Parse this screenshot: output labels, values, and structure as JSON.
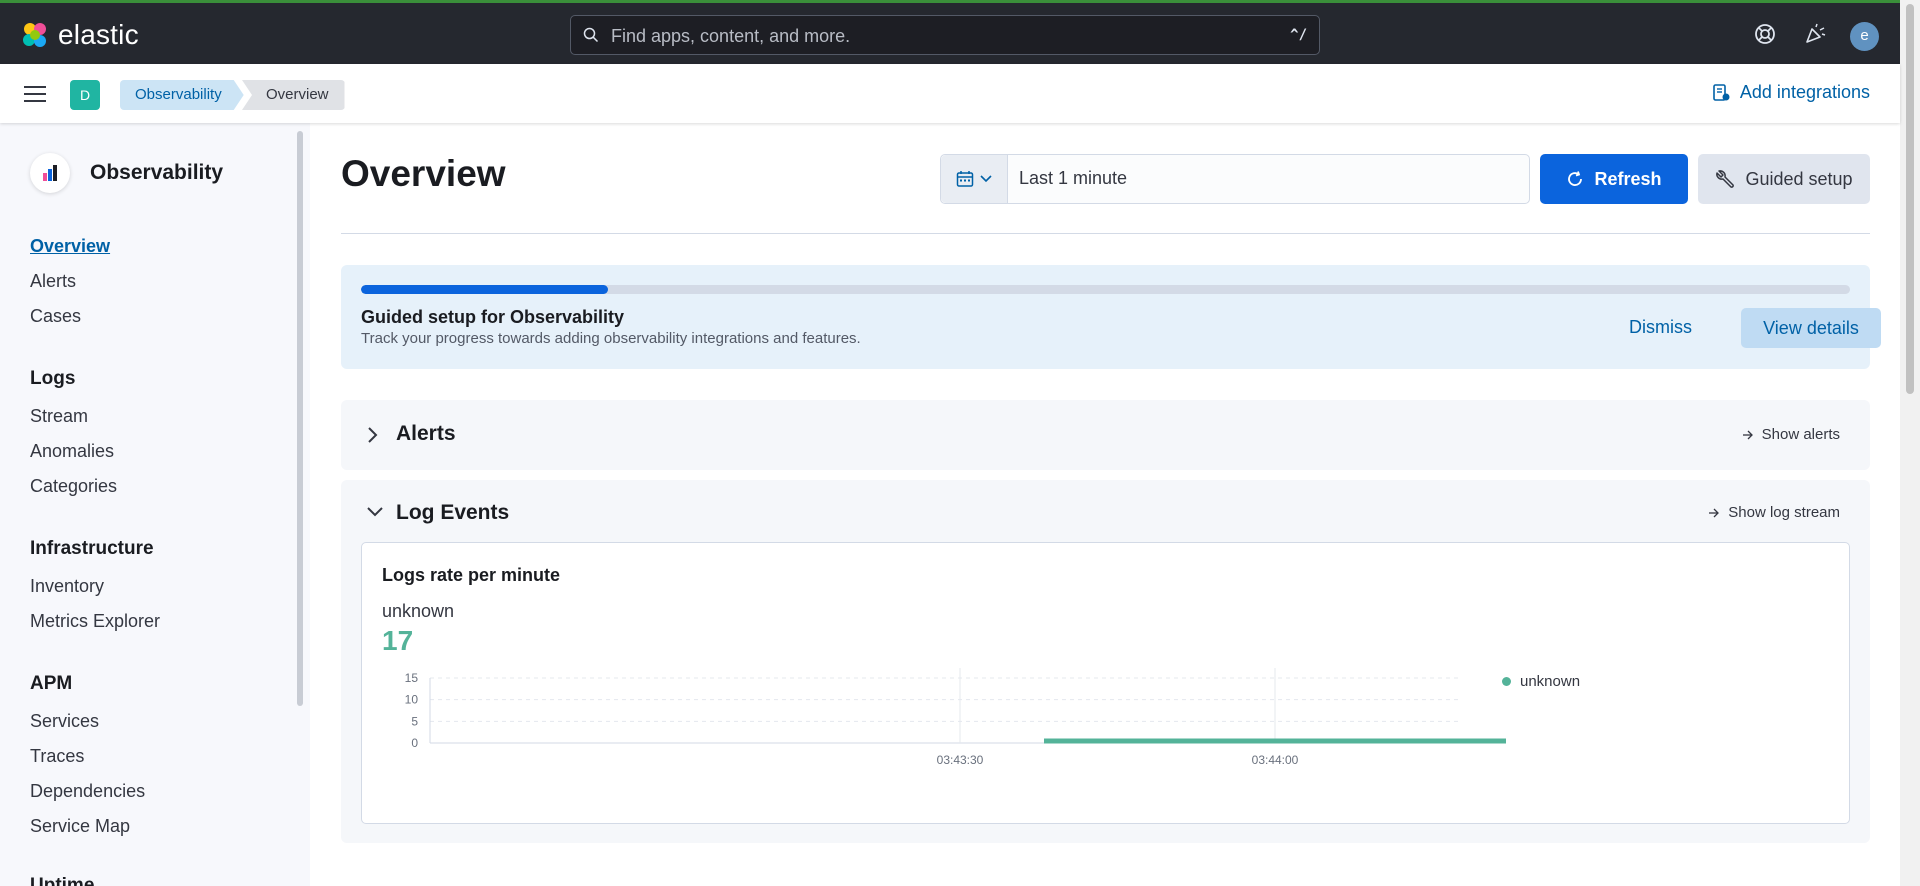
{
  "header": {
    "brand": "elastic",
    "search_placeholder": "Find apps, content, and more.",
    "search_shortcut": "^/",
    "avatar_initial": "e"
  },
  "subheader": {
    "space_initial": "D",
    "breadcrumbs": [
      "Observability",
      "Overview"
    ],
    "add_integrations": "Add integrations"
  },
  "sidebar": {
    "title": "Observability",
    "items": [
      {
        "label": "Overview",
        "active": true
      },
      {
        "label": "Alerts"
      },
      {
        "label": "Cases"
      }
    ],
    "groups": [
      {
        "title": "Logs",
        "items": [
          "Stream",
          "Anomalies",
          "Categories"
        ]
      },
      {
        "title": "Infrastructure",
        "items": [
          "Inventory",
          "Metrics Explorer"
        ]
      },
      {
        "title": "APM",
        "items": [
          "Services",
          "Traces",
          "Dependencies",
          "Service Map"
        ]
      },
      {
        "title": "Uptime",
        "items": []
      }
    ]
  },
  "main": {
    "title": "Overview",
    "date_range": "Last 1 minute",
    "refresh_label": "Refresh",
    "guided_setup_label": "Guided setup",
    "guided_panel": {
      "title": "Guided setup for Observability",
      "description": "Track your progress towards adding observability integrations and features.",
      "progress_fraction": 0.166,
      "dismiss": "Dismiss",
      "view_details": "View details"
    },
    "alerts_section": {
      "title": "Alerts",
      "link": "Show alerts"
    },
    "logs_section": {
      "title": "Log Events",
      "link": "Show log stream",
      "panel_title": "Logs rate per minute",
      "metric_label": "unknown",
      "metric_value": "17"
    }
  },
  "colors": {
    "header_bg": "#25282f",
    "accent": "#0b64dd",
    "series": "#54b399"
  },
  "chart_data": {
    "type": "line",
    "title": "",
    "xlabel": "",
    "ylabel": "",
    "ylim": [
      0,
      15
    ],
    "yticks": [
      0,
      5,
      10,
      15
    ],
    "xticks": [
      "03:43:30",
      "03:44:00"
    ],
    "series": [
      {
        "name": "unknown",
        "x_start": "03:43:38",
        "x_end": "03:44:22",
        "y": 0
      }
    ],
    "legend": "right",
    "grid": true
  }
}
